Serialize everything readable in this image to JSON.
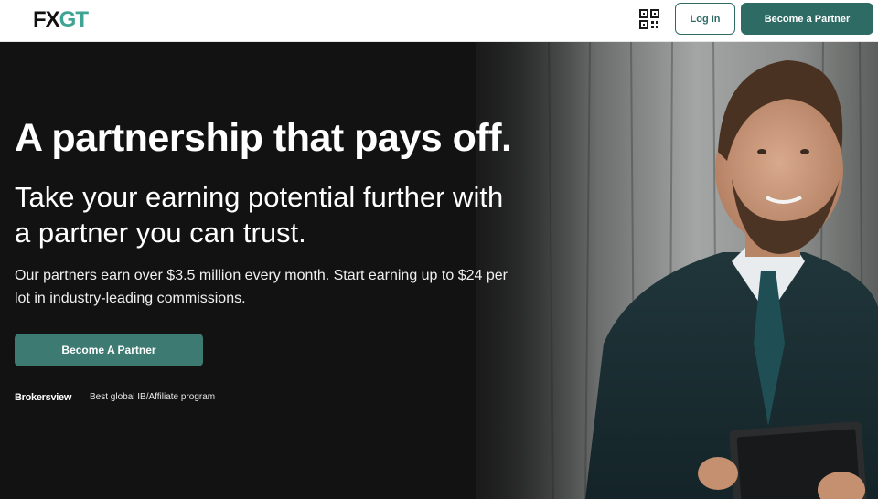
{
  "header": {
    "logo_fx": "FX",
    "logo_gt": "GT",
    "qr_icon": "qr-code-icon",
    "login_label": "Log In",
    "partner_label": "Become a Partner"
  },
  "hero": {
    "title": "A partnership that pays off.",
    "subtitle": "Take your earning potential further with a partner you can trust.",
    "description": "Our partners earn over $3.5 million every month. Start earning up to $24 per lot in industry-leading commissions.",
    "cta_label": "Become A Partner",
    "award_brand": "Brokersview",
    "award_text": "Best global IB/Affiliate program"
  },
  "colors": {
    "brand_dark": "#101010",
    "brand_accent": "#3fa493",
    "button_teal": "#2f6b65",
    "cta_teal": "#3c7a72",
    "hero_bg": "#121212"
  }
}
